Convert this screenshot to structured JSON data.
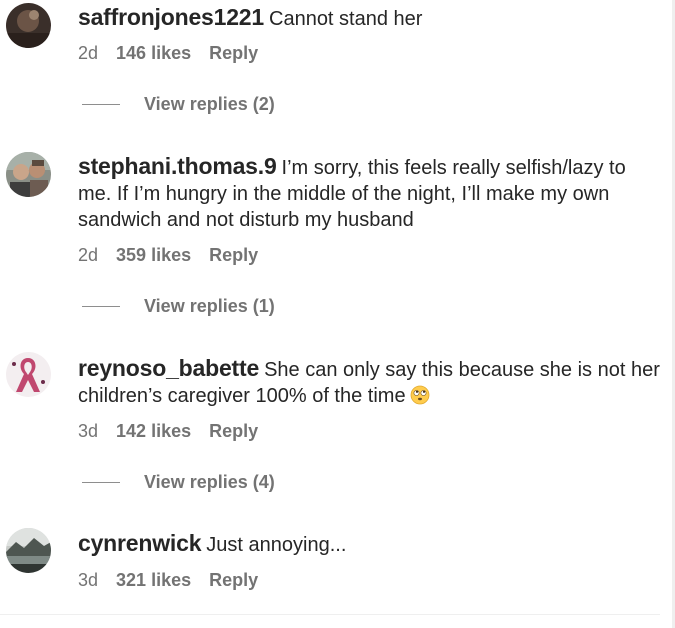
{
  "comments": [
    {
      "username": "saffronjones1221",
      "text": "Cannot stand her",
      "age": "2d",
      "likes": "146 likes",
      "reply": "Reply",
      "view_replies": "View replies (2)",
      "avatar_icon": "avatar-dark-photo"
    },
    {
      "username": "stephani.thomas.9",
      "text": "I’m sorry, this feels really selfish/lazy to me. If I’m hungry in the middle of the night, I’ll make my own sandwich and not disturb my husband",
      "age": "2d",
      "likes": "359 likes",
      "reply": "Reply",
      "view_replies": "View replies (1)",
      "avatar_icon": "avatar-couple-photo"
    },
    {
      "username": "reynoso_babette",
      "text": "She can only say this because she is not her children’s caregiver 100% of the time",
      "emoji": "rolling-eyes-emoji",
      "age": "3d",
      "likes": "142 likes",
      "reply": "Reply",
      "view_replies": "View replies (4)",
      "avatar_icon": "avatar-pink-ribbon"
    },
    {
      "username": "cynrenwick",
      "text": "Just annoying...",
      "age": "3d",
      "likes": "321 likes",
      "reply": "Reply",
      "avatar_icon": "avatar-landscape-photo"
    }
  ],
  "colors": {
    "text": "#262626",
    "secondary": "#737373",
    "divider": "#efefef"
  }
}
